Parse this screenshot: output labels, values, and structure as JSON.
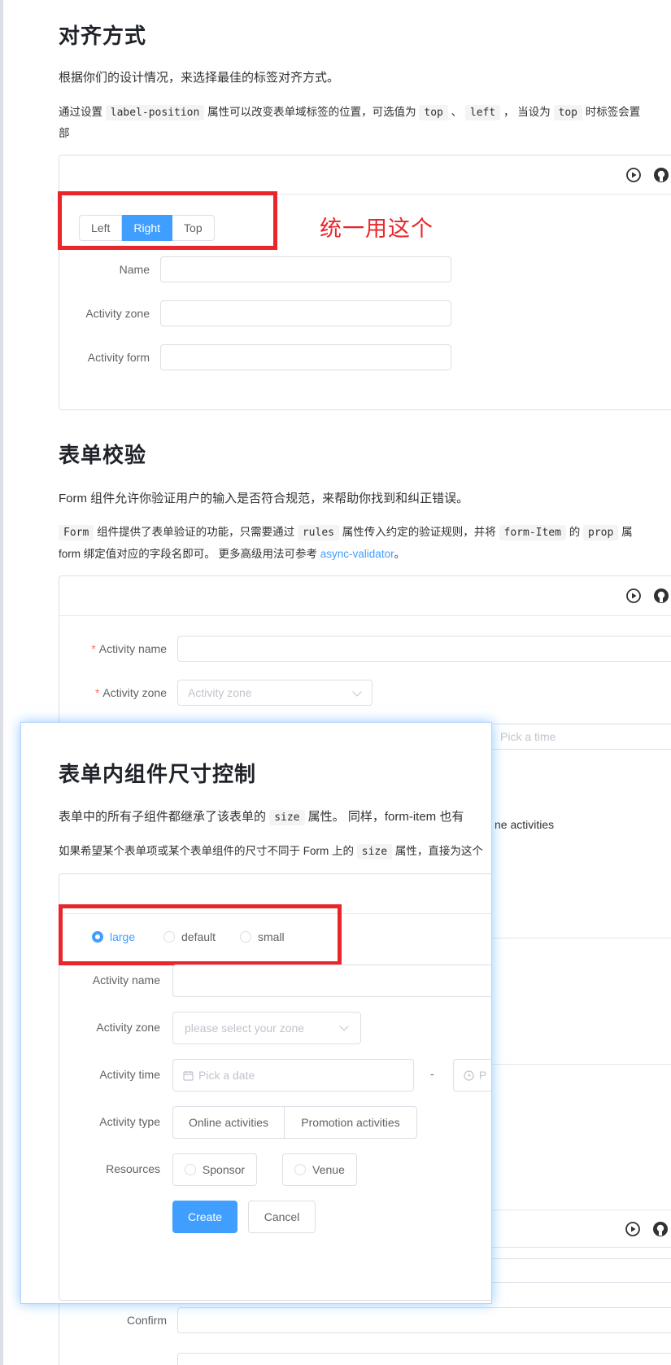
{
  "sec_align": {
    "title": "对齐方式",
    "desc": "根据你们的设计情况，来选择最佳的标签对齐方式。",
    "detail": {
      "p1": "通过设置",
      "code1": "label-position",
      "p2": "属性可以改变表单域标签的位置，可选值为",
      "code2": "top",
      "sep1": "、",
      "code3": "left",
      "p3": "， 当设为",
      "code4": "top",
      "p4": "时标签会置",
      "wrap": "部"
    },
    "segments": [
      "Left",
      "Right",
      "Top"
    ],
    "active_segment": "Right",
    "annotation": "统一用这个",
    "fields": [
      "Name",
      "Activity zone",
      "Activity form"
    ]
  },
  "sec_validate": {
    "title": "表单校验",
    "desc": "Form 组件允许你验证用户的输入是否符合规范，来帮助你找到和纠正错误。",
    "detail": {
      "code1": "Form",
      "p1": "组件提供了表单验证的功能，只需要通过",
      "code2": "rules",
      "p2": "属性传入约定的验证规则，并将",
      "code3": "form-Item",
      "p3": "的",
      "code4": "prop",
      "p4": "属",
      "line2": "form 绑定值对应的字段名即可。 更多高级用法可参考",
      "link": "async-validator",
      "line2_end": "。"
    },
    "fields": {
      "activity_name": "Activity name",
      "activity_zone": "Activity zone",
      "zone_placeholder": "Activity zone",
      "time_placeholder": "Pick a time",
      "peek_text": "ne activities",
      "confirm": "Confirm"
    }
  },
  "sec_size": {
    "title": "表单内组件尺寸控制",
    "desc_p1": "表单中的所有子组件都继承了该表单的",
    "desc_code": "size",
    "desc_p2": "属性。 同样，form-item 也有",
    "detail_p1": "如果希望某个表单项或某个表单组件的尺寸不同于 Form 上的",
    "detail_code": "size",
    "detail_p2": "属性，直接为这个",
    "sizes": [
      "large",
      "default",
      "small"
    ],
    "checked_size": "large",
    "labels": {
      "name": "Activity name",
      "zone": "Activity zone",
      "time": "Activity time",
      "type": "Activity type",
      "resources": "Resources"
    },
    "zone_placeholder": "please select your zone",
    "date_placeholder": "Pick a date",
    "range_sep": "-",
    "time_peek": "P",
    "types": [
      "Online activities",
      "Promotion activities"
    ],
    "resources": [
      "Sponsor",
      "Venue"
    ],
    "create": "Create",
    "cancel": "Cancel"
  },
  "icons": [
    "play-circle-icon",
    "github-icon",
    "calendar-icon",
    "clock-icon",
    "chevron-down-icon"
  ],
  "colors": {
    "primary": "#409eff",
    "annotation": "#e8262b",
    "required": "#f56c6c"
  }
}
